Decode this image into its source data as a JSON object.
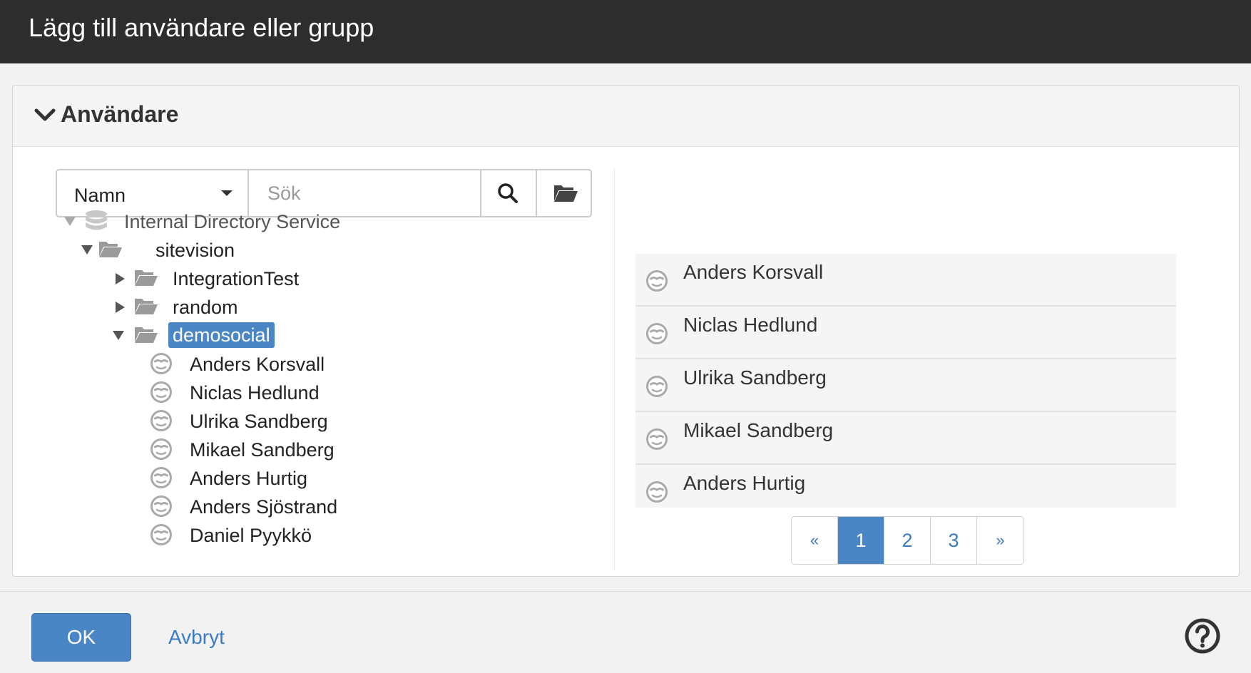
{
  "dialog": {
    "title": "Lägg till användare eller grupp"
  },
  "panel": {
    "title": "Användare"
  },
  "search": {
    "field_select": "Namn",
    "placeholder": "Sök",
    "value": ""
  },
  "tree": {
    "root": {
      "label": "Internal Directory Service",
      "icon": "database-icon",
      "expanded": true
    },
    "site": {
      "label": "sitevision",
      "icon": "folder-open-icon",
      "expanded": true
    },
    "folders": [
      {
        "label": "IntegrationTest",
        "icon": "folder-open-icon",
        "expanded": false
      },
      {
        "label": "random",
        "icon": "folder-open-icon",
        "expanded": false
      },
      {
        "label": "demosocial",
        "icon": "folder-open-icon",
        "expanded": true,
        "selected": true
      }
    ],
    "users": [
      "Anders Korsvall",
      "Niclas Hedlund",
      "Ulrika Sandberg",
      "Mikael Sandberg",
      "Anders Hurtig",
      "Anders Sjöstrand",
      "Daniel Pyykkö"
    ]
  },
  "results": [
    "Anders Korsvall",
    "Niclas Hedlund",
    "Ulrika Sandberg",
    "Mikael Sandberg",
    "Anders Hurtig"
  ],
  "pagination": {
    "prev": "«",
    "pages": [
      "1",
      "2",
      "3"
    ],
    "active": "1",
    "next": "»"
  },
  "footer": {
    "ok_label": "OK",
    "cancel_label": "Avbryt",
    "help_icon": "help-circle-icon"
  },
  "colors": {
    "titlebar": "#2d2d2d",
    "accent": "#4a86c5",
    "link": "#3a7bc8"
  }
}
